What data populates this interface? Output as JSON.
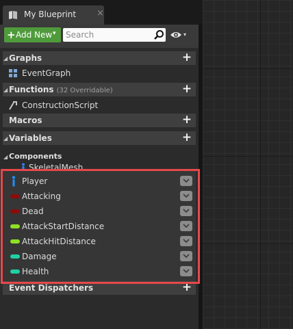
{
  "tab": {
    "title": "My Blueprint",
    "close_label": "×"
  },
  "toolbar": {
    "add_new_label": "Add New",
    "add_new_plus": "+",
    "caret": "▾",
    "search_placeholder": "Search",
    "eye_caret": "▾"
  },
  "sections": {
    "graphs": {
      "label": "Graphs",
      "add": "+",
      "arrow": "◢"
    },
    "functions": {
      "label": "Functions",
      "sub": "(32 Overridable)",
      "add": "+",
      "arrow": "◢"
    },
    "macros": {
      "label": "Macros",
      "add": "+"
    },
    "variables": {
      "label": "Variables",
      "add": "+",
      "arrow": "◢"
    },
    "components": {
      "label": "Components",
      "arrow": "◢"
    },
    "event_dispatchers": {
      "label": "Event Dispatchers",
      "add": "+"
    }
  },
  "items": {
    "event_graph": "EventGraph",
    "construction_script": "ConstructionScript",
    "skeletal_mesh": "SkeletalMesh"
  },
  "variables": [
    {
      "name": "Player",
      "type": "object",
      "color": "#1e90ff"
    },
    {
      "name": "Attacking",
      "type": "bool",
      "color": "#8c0c0c"
    },
    {
      "name": "Dead",
      "type": "bool",
      "color": "#8c0c0c"
    },
    {
      "name": "AttackStartDistance",
      "type": "float",
      "color": "#8fe025"
    },
    {
      "name": "AttackHitDistance",
      "type": "float",
      "color": "#8fe025"
    },
    {
      "name": "Damage",
      "type": "int",
      "color": "#1fd0a4"
    },
    {
      "name": "Health",
      "type": "int",
      "color": "#1fd0a4"
    }
  ],
  "colors": {
    "highlight": "#e8484a",
    "add_new": "#4f9b3b"
  },
  "icons": [
    "blueprint-tab-icon",
    "search-icon",
    "eye-icon",
    "event-graph-icon",
    "function-icon",
    "skeletal-mesh-icon",
    "chevron-down-icon"
  ]
}
